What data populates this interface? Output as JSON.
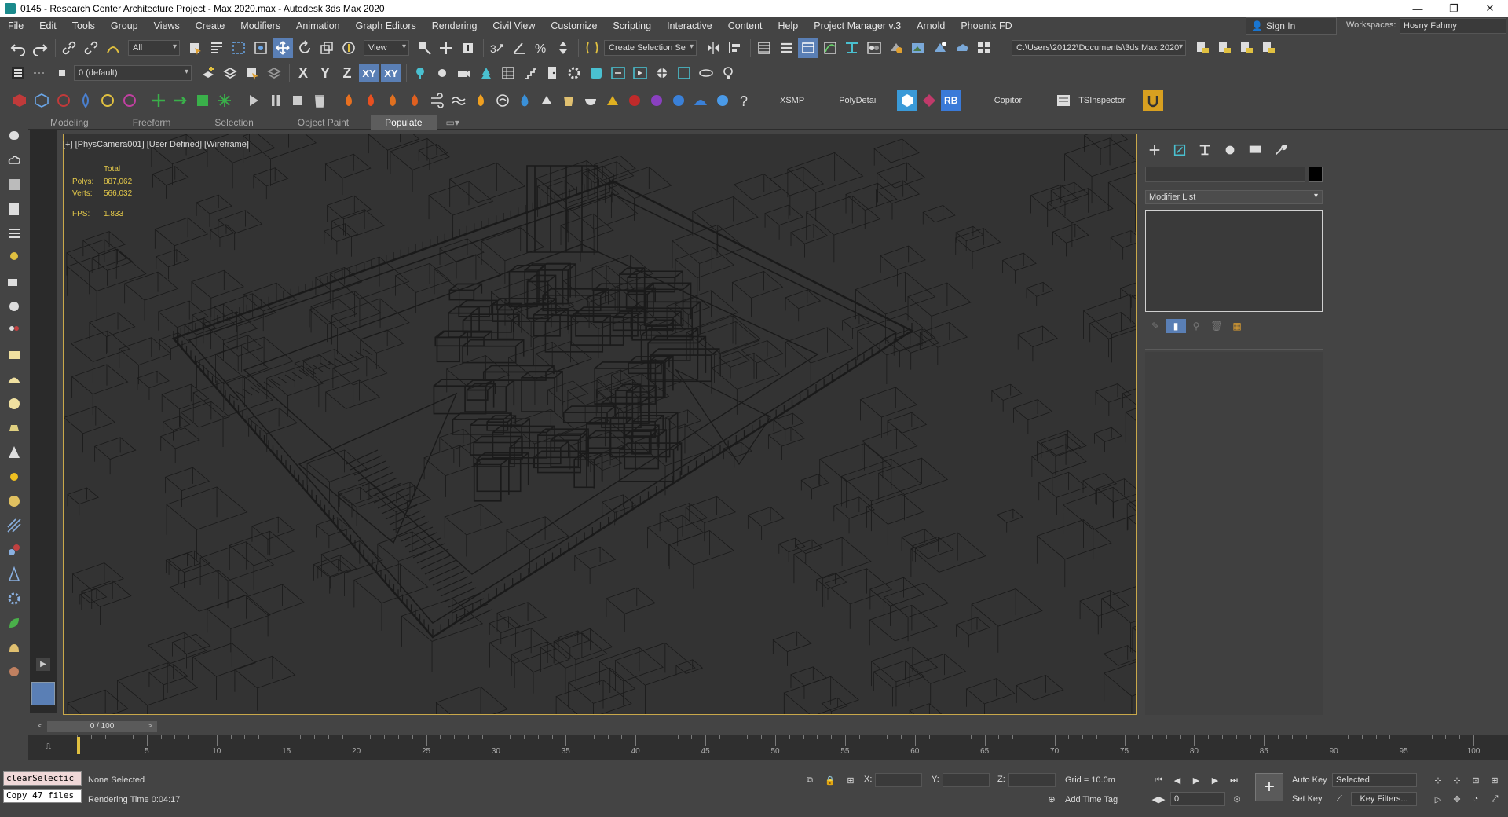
{
  "title": "0145 - Research Center Architecture Project - Max 2020.max - Autodesk 3ds Max 2020",
  "window_controls": [
    "—",
    "❐",
    "✕"
  ],
  "menu": [
    "File",
    "Edit",
    "Tools",
    "Group",
    "Views",
    "Create",
    "Modifiers",
    "Animation",
    "Graph Editors",
    "Rendering",
    "Civil View",
    "Customize",
    "Scripting",
    "Interactive",
    "Content",
    "Help",
    "Project Manager v.3",
    "Arnold",
    "Phoenix FD"
  ],
  "account": {
    "sign_in": "Sign In",
    "workspaces_label": "Workspaces:",
    "workspace": "Hosny Fahmy"
  },
  "toolbar1": {
    "filter": "All",
    "ref_coord": "View",
    "named_selection": "Create Selection Se",
    "project_path": "C:\\Users\\20122\\Documents\\3ds Max 2020"
  },
  "toolbar2": {
    "layer": "0 (default)",
    "axes": [
      "X",
      "Y",
      "Z",
      "XY",
      "XY"
    ]
  },
  "toolbar3": {
    "plugins": [
      "XSMP",
      "PolyDetail",
      "RB",
      "Copitor",
      "TSInspector"
    ]
  },
  "ribbon_tabs": [
    "Modeling",
    "Freeform",
    "Selection",
    "Object Paint",
    "Populate"
  ],
  "viewport": {
    "label": "[+] [PhysCamera001] [User Defined] [Wireframe]",
    "stats": {
      "header": "Total",
      "polys_label": "Polys:",
      "polys": "887,062",
      "verts_label": "Verts:",
      "verts": "566,032",
      "fps_label": "FPS:",
      "fps": "1.833"
    }
  },
  "command_panel": {
    "modifier_list": "Modifier List"
  },
  "timeslider": {
    "frame": "0 / 100",
    "prev": "<",
    "next": ">"
  },
  "trackbar": {
    "ticks": [
      "0",
      "5",
      "10",
      "15",
      "20",
      "25",
      "30",
      "35",
      "40",
      "45",
      "50",
      "55",
      "60",
      "65",
      "70",
      "75",
      "80",
      "85",
      "90",
      "95",
      "100"
    ]
  },
  "status": {
    "maxscript_line1": "clearSelectic",
    "maxscript_line2": "Copy 47 files",
    "selection": "None Selected",
    "render_time": "Rendering Time  0:04:17",
    "x_label": "X:",
    "y_label": "Y:",
    "z_label": "Z:",
    "grid": "Grid = 10.0m",
    "add_time_tag": "Add Time Tag",
    "auto_key": "Auto Key",
    "set_key": "Set Key",
    "key_mode": "Selected",
    "key_filters": "Key Filters...",
    "current_frame": "0"
  }
}
